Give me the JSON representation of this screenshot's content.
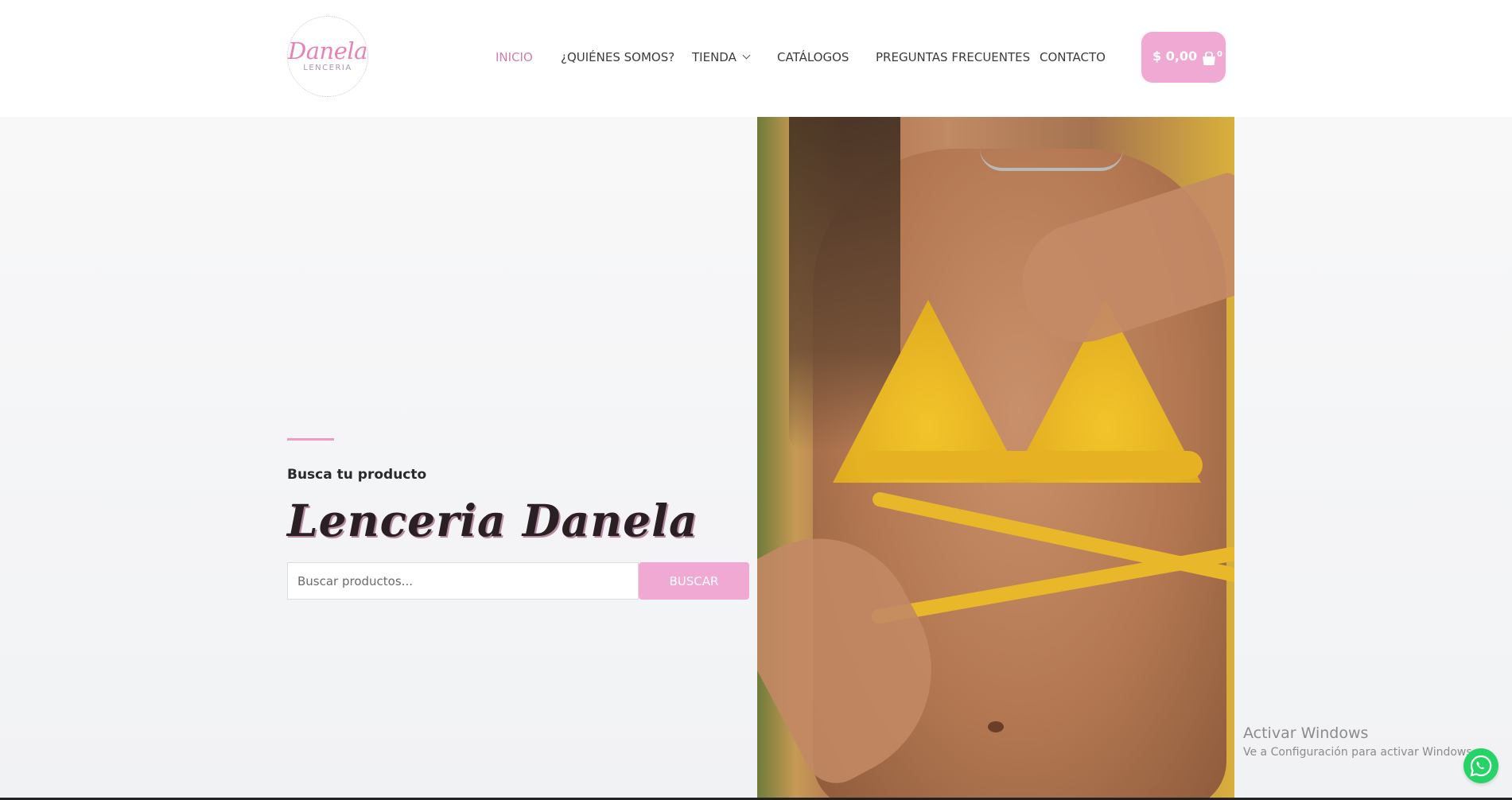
{
  "logo": {
    "script": "Danela",
    "sub": "LENCERIA"
  },
  "nav": {
    "items": [
      {
        "label": "INICIO"
      },
      {
        "label": "¿QUIÉNES SOMOS?"
      },
      {
        "label": "TIENDA"
      },
      {
        "label": "CATÁLOGOS"
      },
      {
        "label": "PREGUNTAS FRECUENTES"
      },
      {
        "label": "CONTACTO"
      }
    ],
    "active_color": "#d47cae"
  },
  "cart": {
    "amount": "$ 0,00",
    "count": "0",
    "color": "#f0a9d2"
  },
  "hero": {
    "kicker": "Busca tu producto",
    "title": "Lenceria Danela",
    "accent_color": "#ef9bc6"
  },
  "search": {
    "placeholder": "Buscar productos...",
    "value": "",
    "button": "BUSCAR"
  },
  "watermark": {
    "title": "Activar Windows",
    "sub": "Ve a Configuración para activar Windows."
  },
  "icons": {
    "cart": "shopping-bag-icon",
    "whatsapp": "whatsapp-icon",
    "dropdown": "chevron-down-icon"
  }
}
